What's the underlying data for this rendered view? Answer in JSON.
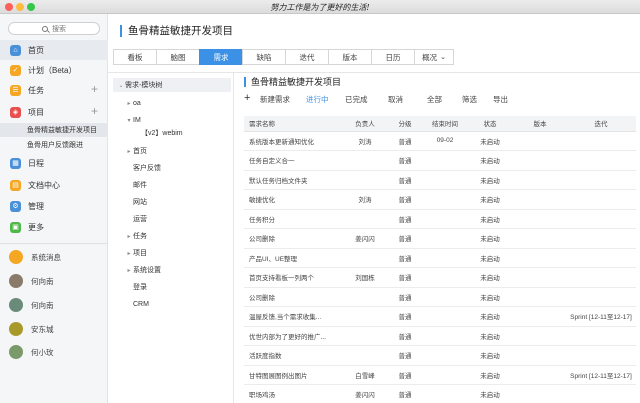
{
  "window": {
    "title": "努力工作是为了更好的生活!"
  },
  "sidebar": {
    "search_placeholder": "搜索",
    "nav": [
      {
        "label": "首页",
        "icon": "home-icon",
        "color": "#4a90d9"
      },
      {
        "label": "计划（Beta）",
        "icon": "plan-icon",
        "color": "#f5a623"
      },
      {
        "label": "任务",
        "icon": "task-icon",
        "color": "#f5a623"
      },
      {
        "label": "项目",
        "icon": "project-icon",
        "color": "#e94f4f"
      }
    ],
    "project_items": [
      "鱼骨精益敏捷开发项目",
      "鱼骨用户反馈跟进"
    ],
    "nav2": [
      {
        "label": "日程",
        "icon": "calendar-icon",
        "color": "#4a90d9"
      },
      {
        "label": "文档中心",
        "icon": "document-icon",
        "color": "#f5a623"
      },
      {
        "label": "管理",
        "icon": "manage-icon",
        "color": "#4a90d9"
      },
      {
        "label": "更多",
        "icon": "more-icon",
        "color": "#50b848"
      }
    ],
    "contacts": [
      {
        "label": "系统消息",
        "color": "#f5a623"
      },
      {
        "label": "何向南",
        "color": "#8a7a6a"
      },
      {
        "label": "何向南",
        "color": "#6a8a7a"
      },
      {
        "label": "安东城",
        "color": "#a89a2a"
      },
      {
        "label": "何小玫",
        "color": "#7a9a6a"
      }
    ]
  },
  "project": {
    "title": "鱼骨精益敏捷开发项目",
    "tabs": [
      "看板",
      "脑图",
      "需求",
      "缺陷",
      "迭代",
      "版本",
      "日历",
      "概况"
    ],
    "active_tab": "需求"
  },
  "tree": {
    "root": "需求-模块树",
    "items": [
      {
        "label": "oa",
        "caret": "▸"
      },
      {
        "label": "IM",
        "caret": "▾"
      },
      {
        "label": "【v2】webim",
        "caret": ""
      },
      {
        "label": "首页",
        "caret": "▸"
      },
      {
        "label": "客户反馈",
        "caret": ""
      },
      {
        "label": "邮件",
        "caret": ""
      },
      {
        "label": "网站",
        "caret": ""
      },
      {
        "label": "运营",
        "caret": ""
      },
      {
        "label": "任务",
        "caret": "▸"
      },
      {
        "label": "项目",
        "caret": "▸"
      },
      {
        "label": "系统设置",
        "caret": "▸"
      },
      {
        "label": "登录",
        "caret": ""
      },
      {
        "label": "CRM",
        "caret": ""
      }
    ]
  },
  "list": {
    "title": "鱼骨精益敏捷开发项目",
    "toolbar": {
      "add": "新建需求",
      "filters": [
        "进行中",
        "已完成",
        "取消",
        "全部"
      ],
      "active_filter": "进行中",
      "screen": "筛选",
      "export": "导出"
    },
    "columns": [
      "需求名称",
      "负责人",
      "分级",
      "结束时间",
      "状态",
      "版本",
      "迭代"
    ],
    "rows": [
      [
        "系统版本更新通知优化",
        "刘涛",
        "普通",
        "09-02",
        "未启动",
        "",
        ""
      ],
      [
        "任务自定义合一",
        "",
        "普通",
        "",
        "未启动",
        "",
        ""
      ],
      [
        "默认任务归档文件夹",
        "",
        "普通",
        "",
        "未启动",
        "",
        ""
      ],
      [
        "敏捷优化",
        "刘涛",
        "普通",
        "",
        "未启动",
        "",
        ""
      ],
      [
        "任务积分",
        "",
        "普通",
        "",
        "未启动",
        "",
        ""
      ],
      [
        "公司删除",
        "姜闪闪",
        "普通",
        "",
        "未启动",
        "",
        ""
      ],
      [
        "产品UI、UE整理",
        "",
        "普通",
        "",
        "未启动",
        "",
        ""
      ],
      [
        "首页支持看板一列两个",
        "刘国栋",
        "普通",
        "",
        "未启动",
        "",
        ""
      ],
      [
        "公司删除",
        "",
        "普通",
        "",
        "未启动",
        "",
        ""
      ],
      [
        "温屋反馈,当个需求收集...",
        "",
        "普通",
        "",
        "未启动",
        "",
        "Sprint [12-11至12-17]"
      ],
      [
        "优世内部为了更好的推广...",
        "",
        "普通",
        "",
        "未启动",
        "",
        ""
      ],
      [
        "活跃度指数",
        "",
        "普通",
        "",
        "未启动",
        "",
        ""
      ],
      [
        "甘特图展图例出图片",
        "白雪峰",
        "普通",
        "",
        "未启动",
        "",
        "Sprint [12-11至12-17]"
      ],
      [
        "职场鸡汤",
        "姜闪闪",
        "普通",
        "",
        "未启动",
        "",
        ""
      ]
    ]
  }
}
